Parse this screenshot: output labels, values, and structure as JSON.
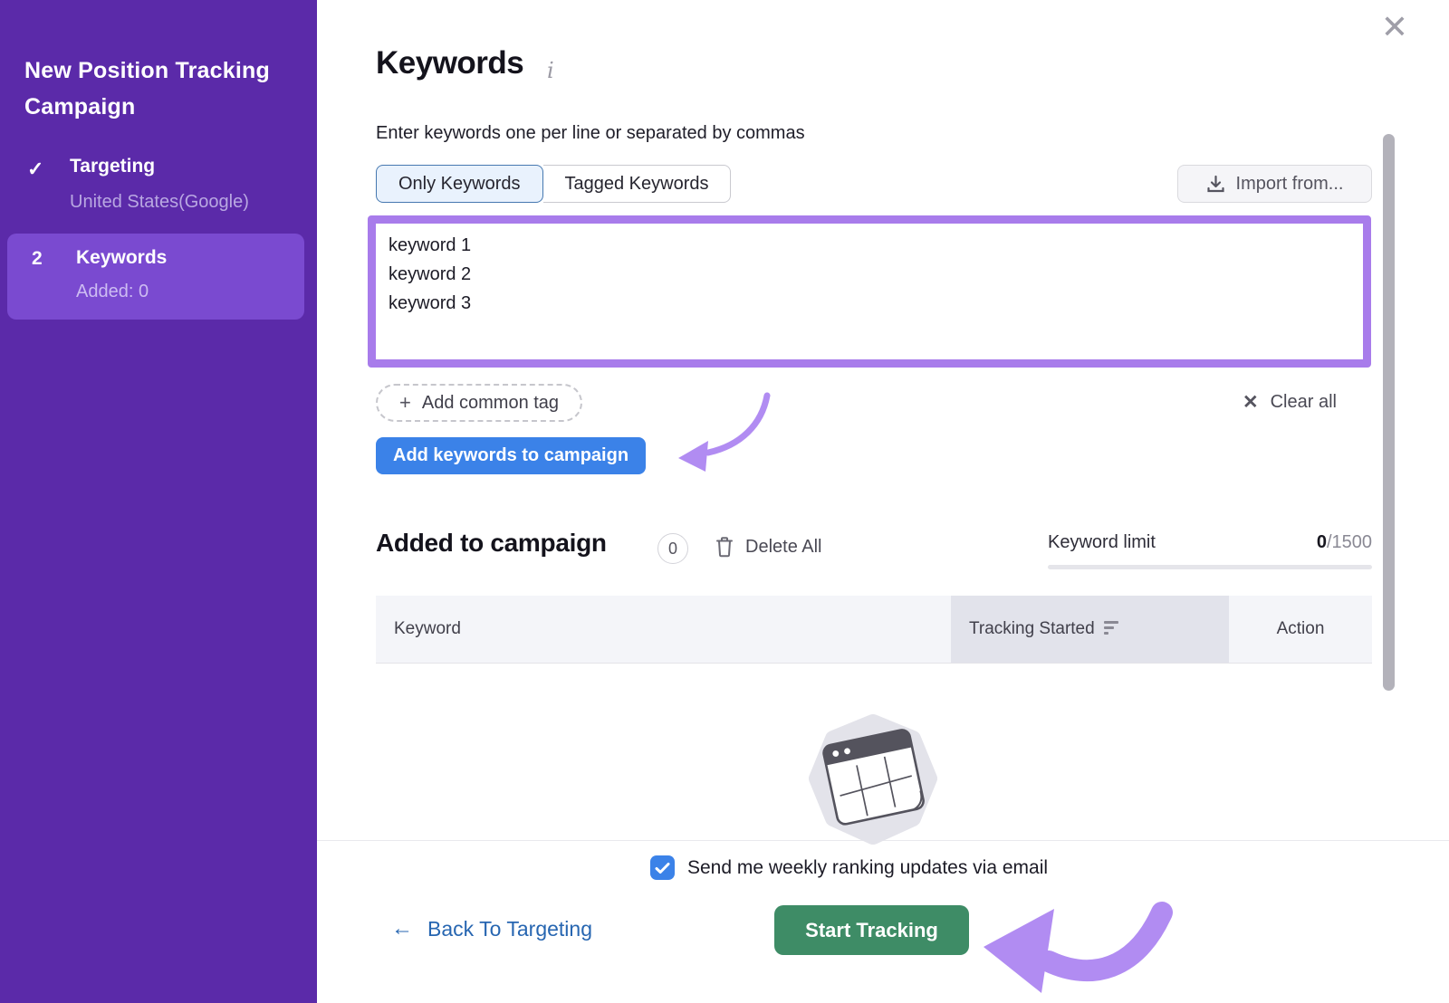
{
  "sidebar": {
    "title": "New Position Tracking Campaign",
    "steps": [
      {
        "icon": "✓",
        "label": "Targeting",
        "sublabel": "United States(Google)",
        "state": "completed"
      },
      {
        "number": "2",
        "label": "Keywords",
        "sublabel": "Added: 0",
        "state": "active"
      }
    ]
  },
  "header": {
    "title": "Keywords",
    "info_icon": "i",
    "close_icon": "✕"
  },
  "keywords_section": {
    "instruction": "Enter keywords one per line or separated by commas",
    "tabs": [
      {
        "label": "Only Keywords",
        "active": true
      },
      {
        "label": "Tagged Keywords",
        "active": false
      }
    ],
    "import_button_label": "Import from...",
    "textarea_value": "keyword 1\nkeyword 2\nkeyword 3",
    "add_common_tag": {
      "plus_icon": "+",
      "label": "Add common tag"
    },
    "clear_all": {
      "x_icon": "✕",
      "label": "Clear all"
    },
    "add_button_label": "Add keywords to campaign"
  },
  "added_section": {
    "title": "Added to campaign",
    "count_badge": "0",
    "delete_all_label": "Delete All",
    "keyword_limit_label": "Keyword limit",
    "keyword_limit_used": "0",
    "keyword_limit_total": "/1500",
    "table_headers": [
      "Keyword",
      "Tracking Started",
      "Action"
    ]
  },
  "footer": {
    "email_checkbox_label": "Send me weekly ranking updates via email",
    "email_checkbox_checked": true,
    "back_link_label": "Back To Targeting",
    "back_arrow_icon": "←",
    "start_button_label": "Start Tracking"
  },
  "colors": {
    "sidebar_purple": "#5b2aa9",
    "active_step_purple": "#7a4ad0",
    "textarea_border_purple": "#a87ceb",
    "annotation_arrow_purple": "#b18cf2",
    "primary_blue": "#3b82e8",
    "success_green": "#3e8c66",
    "link_blue": "#2766b1"
  }
}
